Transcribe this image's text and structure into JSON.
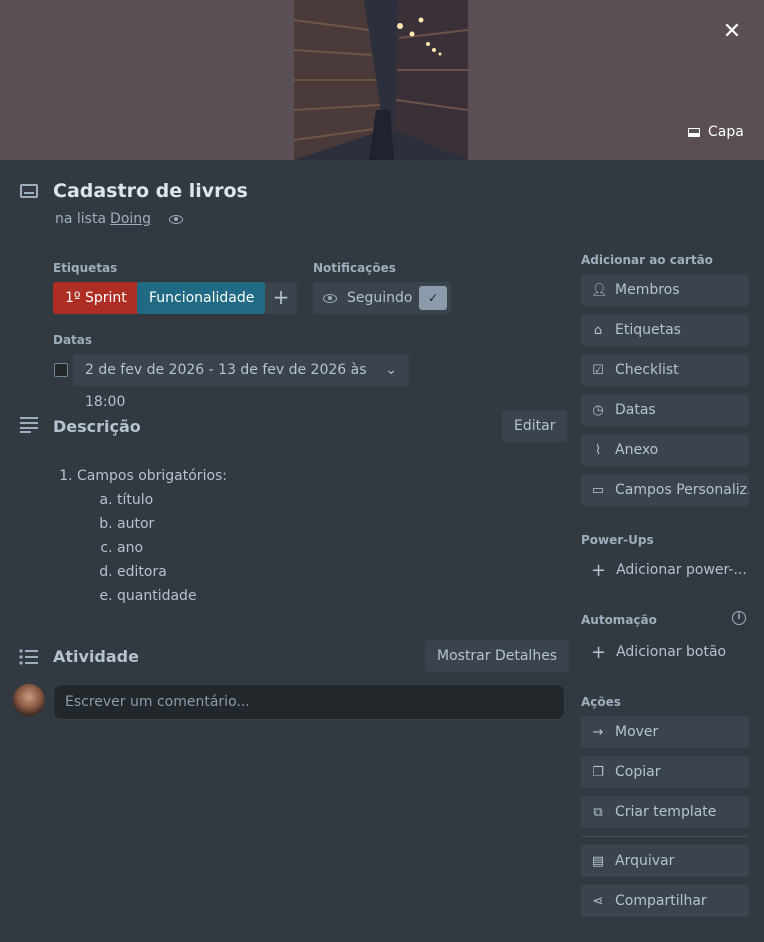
{
  "cover": {
    "button_label": "Capa",
    "close_label": "✕"
  },
  "card": {
    "title": "Cadastro de livros",
    "list_prefix": "na lista",
    "list_name": "Doing"
  },
  "labels": {
    "heading": "Etiquetas",
    "items": [
      {
        "text": "1º Sprint",
        "color": "#ae2e24"
      },
      {
        "text": "Funcionalidade",
        "color": "#206a83"
      }
    ],
    "add_label": "+"
  },
  "notifications": {
    "heading": "Notificações",
    "button_label": "Seguindo",
    "checked": true
  },
  "dates": {
    "heading": "Datas",
    "value": "2 de fev de 2026 - 13 de fev de 2026 às 18:00"
  },
  "description": {
    "heading": "Descrição",
    "edit_label": "Editar",
    "item": "Campos obrigatórios:",
    "subitems": [
      "título",
      "autor",
      "ano",
      "editora",
      "quantidade"
    ]
  },
  "activity": {
    "heading": "Atividade",
    "details_label": "Mostrar Detalhes",
    "comment_placeholder": "Escrever um comentário..."
  },
  "sidebar": {
    "add_heading": "Adicionar ao cartão",
    "add_items": [
      {
        "label": "Membros",
        "icon": "user-icon"
      },
      {
        "label": "Etiquetas",
        "icon": "tag-icon"
      },
      {
        "label": "Checklist",
        "icon": "checklist-icon"
      },
      {
        "label": "Datas",
        "icon": "clock-icon"
      },
      {
        "label": "Anexo",
        "icon": "paperclip-icon"
      },
      {
        "label": "Campos Personaliz...",
        "icon": "custom-fields-icon"
      }
    ],
    "powerups_heading": "Power-Ups",
    "powerups_add": "Adicionar power-...",
    "automation_heading": "Automação",
    "automation_add": "Adicionar botão",
    "actions_heading": "Ações",
    "actions": [
      {
        "label": "Mover",
        "icon": "arrow-right-icon"
      },
      {
        "label": "Copiar",
        "icon": "copy-icon"
      },
      {
        "label": "Criar template",
        "icon": "template-icon"
      },
      {
        "label": "Arquivar",
        "icon": "archive-icon"
      },
      {
        "label": "Compartilhar",
        "icon": "share-icon"
      }
    ]
  }
}
